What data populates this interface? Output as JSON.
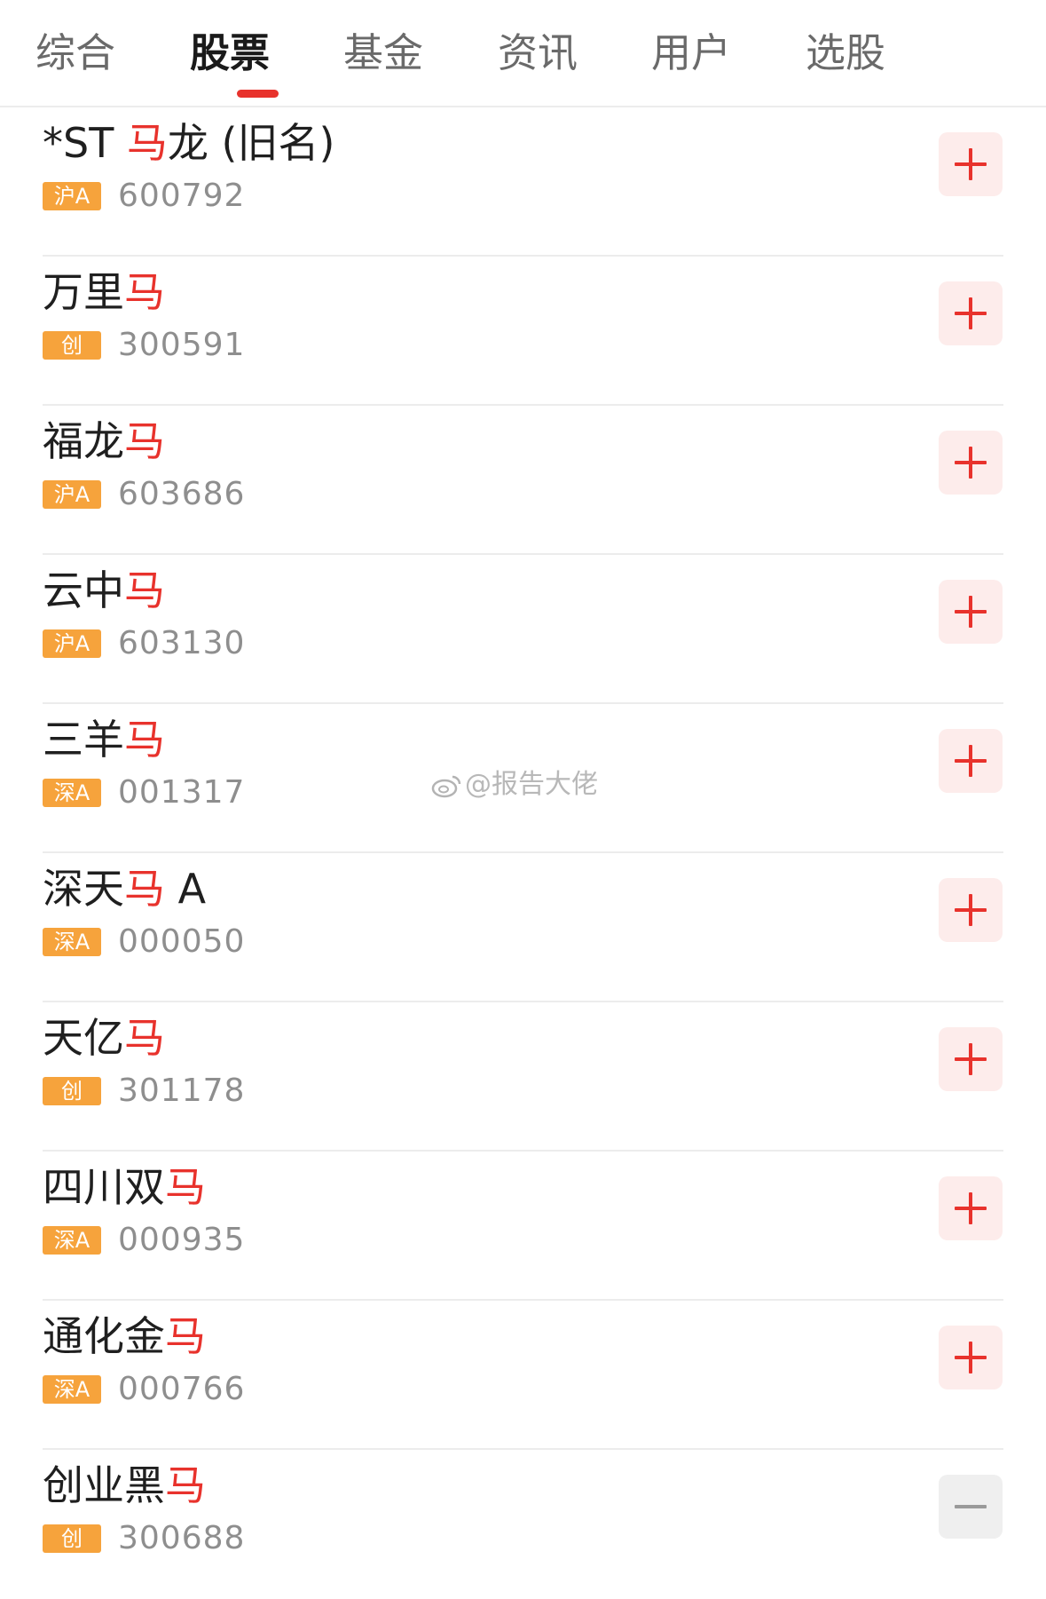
{
  "tabs": [
    {
      "label": "综合",
      "active": false
    },
    {
      "label": "股票",
      "active": true
    },
    {
      "label": "基金",
      "active": false
    },
    {
      "label": "资讯",
      "active": false
    },
    {
      "label": "用户",
      "active": false
    },
    {
      "label": "选股",
      "active": false
    }
  ],
  "results": [
    {
      "name_pre": "*ST ",
      "name_hl": "马",
      "name_post": "龙 (旧名)",
      "badge": "沪A",
      "code": "600792",
      "action": "add"
    },
    {
      "name_pre": "万里",
      "name_hl": "马",
      "name_post": "",
      "badge": "创",
      "code": "300591",
      "action": "add"
    },
    {
      "name_pre": "福龙",
      "name_hl": "马",
      "name_post": "",
      "badge": "沪A",
      "code": "603686",
      "action": "add"
    },
    {
      "name_pre": "云中",
      "name_hl": "马",
      "name_post": "",
      "badge": "沪A",
      "code": "603130",
      "action": "add"
    },
    {
      "name_pre": "三羊",
      "name_hl": "马",
      "name_post": "",
      "badge": "深A",
      "code": "001317",
      "action": "add"
    },
    {
      "name_pre": "深天",
      "name_hl": "马",
      "name_post": " A",
      "badge": "深A",
      "code": "000050",
      "action": "add"
    },
    {
      "name_pre": "天亿",
      "name_hl": "马",
      "name_post": "",
      "badge": "创",
      "code": "301178",
      "action": "add"
    },
    {
      "name_pre": "四川双",
      "name_hl": "马",
      "name_post": "",
      "badge": "深A",
      "code": "000935",
      "action": "add"
    },
    {
      "name_pre": "通化金",
      "name_hl": "马",
      "name_post": "",
      "badge": "深A",
      "code": "000766",
      "action": "add"
    },
    {
      "name_pre": "创业黑",
      "name_hl": "马",
      "name_post": "",
      "badge": "创",
      "code": "300688",
      "action": "remove"
    }
  ],
  "watermark": {
    "text": "@报告大佬",
    "icon": "weibo-icon"
  },
  "colors": {
    "accent": "#e8322c",
    "badge": "#f6a33c",
    "add_bg": "#fdeceb",
    "added_bg": "#efefef"
  }
}
